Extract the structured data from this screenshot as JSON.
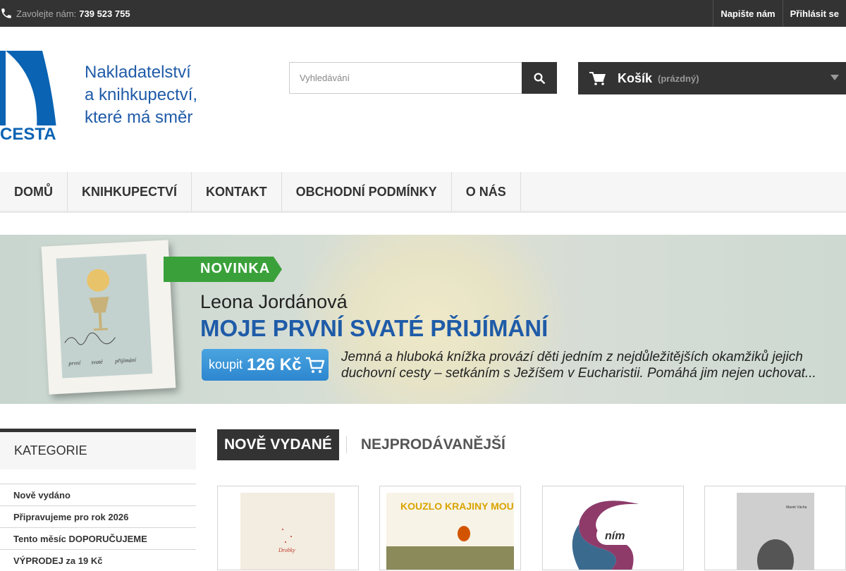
{
  "topbar": {
    "call_label": "Zavolejte nám:",
    "phone": "739 523 755",
    "links": [
      "Napište nám",
      "Přihlásit se"
    ]
  },
  "logo": {
    "name": "CESTA",
    "tagline": [
      "Nakladatelství",
      "a knihkupectví,",
      "které má směr"
    ]
  },
  "search": {
    "placeholder": "Vyhledávání"
  },
  "cart": {
    "title": "Košík",
    "state": "(prázdný)"
  },
  "menu": [
    "DOMŮ",
    "KNIHKUPECTVÍ",
    "KONTAKT",
    "OBCHODNÍ PODMÍNKY",
    "O NÁS"
  ],
  "banner": {
    "badge": "NOVINKA",
    "author": "Leona Jordánová",
    "title": "MOJE PRVNÍ SVATÉ PŘIJÍMÁNÍ",
    "buy_label": "koupit",
    "price": "126 Kč",
    "description": "Jemná a hluboká knížka provází děti jedním z nejdůležitějších okamžiků jejich duchovní cesty – setkáním s Ježíšem v Eucharistii. Pomáhá jim nejen uchovat...",
    "book_cover_text": [
      "moje",
      "první",
      "svaté",
      "přijímání"
    ]
  },
  "sidebar": {
    "title": "KATEGORIE",
    "items": [
      "Nově vydáno",
      "Připravujeme pro rok 2026",
      "Tento měsíc DOPORUČUJEME",
      "VÝPRODEJ za 19 Kč"
    ]
  },
  "tabs": [
    "NOVĚ VYDANÉ",
    "NEJPRODÁVANĚJŠÍ"
  ],
  "products": [
    {
      "cover_text": "Drobky"
    },
    {
      "cover_text": "KOUZLO KRAJINY MOUDROST SLOVA"
    },
    {
      "cover_text": "ním"
    },
    {
      "cover_text": "Marek Vácha"
    }
  ],
  "colors": {
    "dark": "#333333",
    "accent_blue": "#1f5ba8",
    "badge_green": "#3aa13a"
  }
}
